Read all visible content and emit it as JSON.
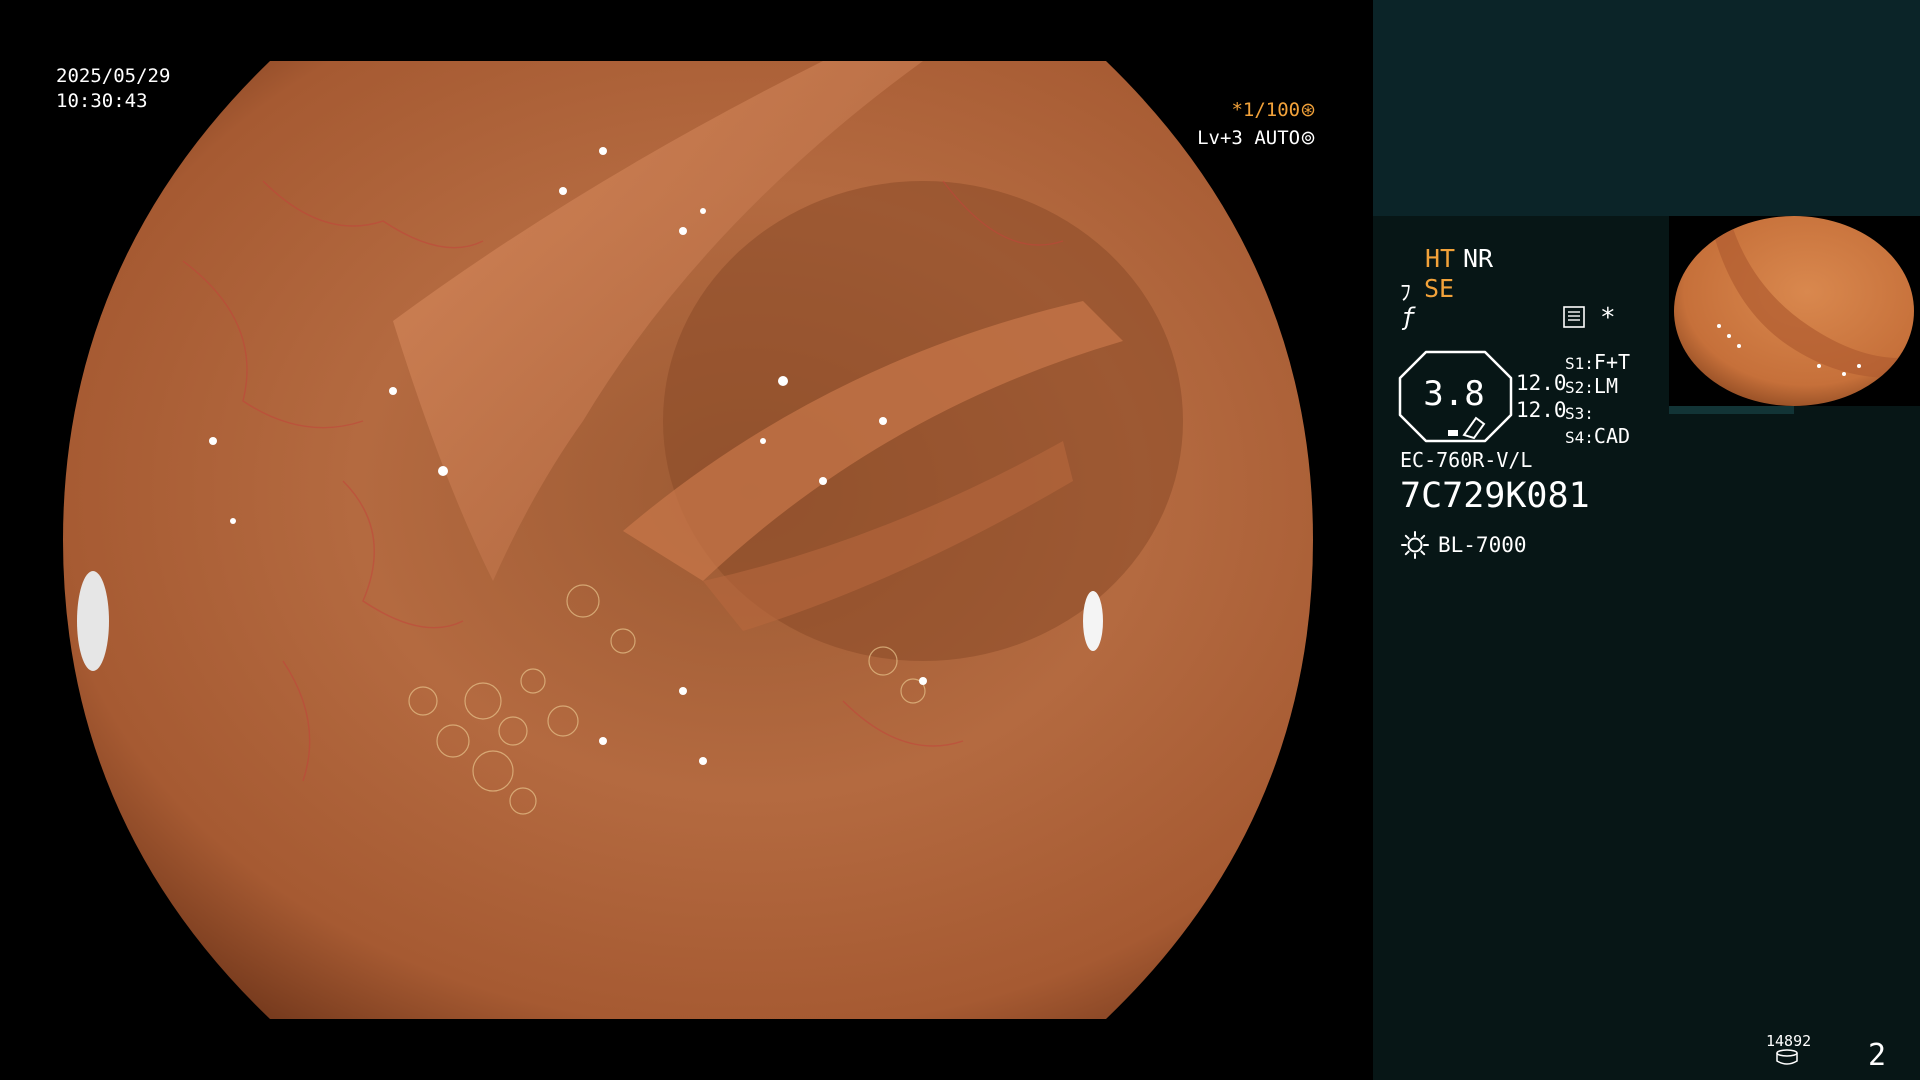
{
  "overlay": {
    "date": "2025/05/29",
    "time": "10:30:43",
    "shutter": "*1/100",
    "shutter_icon": "aperture-icon",
    "level": "Lv+3",
    "auto_mode": "AUTO",
    "auto_icon": "iris-icon"
  },
  "panel": {
    "ht": "HT",
    "nr": "NR",
    "se": "SE",
    "se_icon": "scope-tip-icon",
    "f_icon": "lightning-icon",
    "report_icon": "report-icon",
    "asterisk": "*",
    "gauge_value": "3.8",
    "value_a": "12.0",
    "value_b": "12.0",
    "switches": [
      {
        "label": "S1:",
        "value": "F+T"
      },
      {
        "label": "S2:",
        "value": "LM"
      },
      {
        "label": "S3:",
        "value": ""
      },
      {
        "label": "S4:",
        "value": "CAD"
      }
    ],
    "scope_model": "EC-760R-V/L",
    "serial": "7C729K081",
    "light_icon": "sun-icon",
    "light_source": "BL-7000"
  },
  "footer": {
    "count": "14892",
    "count_icon": "disk-icon",
    "page_number": "2"
  },
  "colors": {
    "accent_orange": "#f2a23a",
    "panel_top": "#0b2428",
    "panel_bg": "#071616",
    "tissue": "#b0643a"
  }
}
